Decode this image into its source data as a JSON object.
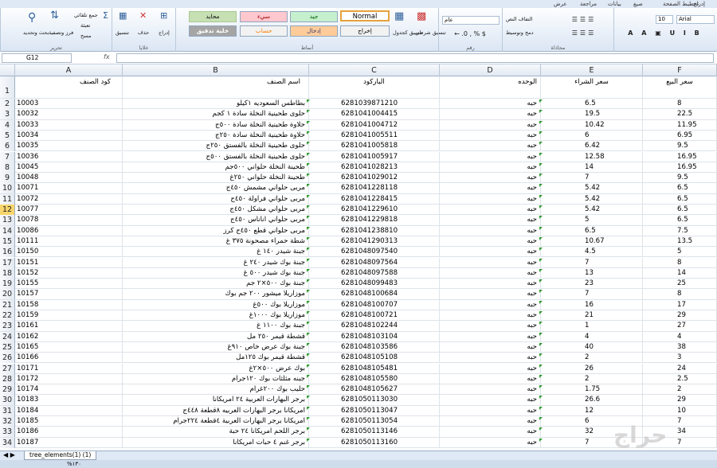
{
  "tabs": [
    "إدراج",
    "تخطيط الصفحة",
    "صيغ",
    "بيانات",
    "مراجعة",
    "عرض"
  ],
  "ribbon": {
    "font": {
      "name": "Arial",
      "size": "10",
      "label": ""
    },
    "alignment": {
      "wrap": "التفاف النص",
      "merge": "دمج وتوسيط",
      "label": "محاذاة"
    },
    "number": {
      "format": "عام",
      "label": "رقم"
    },
    "styles": {
      "conditional": "تنسيق شرطي",
      "as_table": "تنسيق كجدول",
      "boxes": [
        "Normal",
        "جيد",
        "سيء",
        "محايد",
        "إخراج",
        "إدخال",
        "حساب",
        "خلية تدقيق"
      ],
      "label": "أنماط"
    },
    "cells": {
      "insert": "إدراج",
      "delete": "حذف",
      "format": "تنسيق",
      "label": "خلايا"
    },
    "editing": {
      "autosum": "جمع تلقائي",
      "fill": "تعبئة",
      "clear": "مسح",
      "sort": "فرز وتصفية",
      "find": "بحث وتحديد",
      "label": "تحرير"
    }
  },
  "formula_bar": {
    "name_box": "G12",
    "fx": "fx",
    "content": ""
  },
  "columns": [
    "A",
    "B",
    "C",
    "D",
    "E",
    "F"
  ],
  "header_row": {
    "num": "1",
    "a": "كود الصنف",
    "b": "اسم الصنف",
    "c": "الباركود",
    "d": "الوحده",
    "e": "سعر الشراء",
    "f": "سعر البيع"
  },
  "rows": [
    {
      "num": "2",
      "a": "10003",
      "b": "بطاطس السعوديه ١كيلو",
      "c": "6281039871210",
      "d": "حبه",
      "e": "6.5",
      "f": "8"
    },
    {
      "num": "3",
      "a": "10032",
      "b": "حلوى طحينية النخلة سادة ١ كجم",
      "c": "6281041004415",
      "d": "حبه",
      "e": "19.5",
      "f": "22.5"
    },
    {
      "num": "4",
      "a": "10033",
      "b": "حلاوة طحينية النخلة سادة ٥٠٠ج",
      "c": "6281041004712",
      "d": "حبه",
      "e": "10.42",
      "f": "11.95"
    },
    {
      "num": "5",
      "a": "10034",
      "b": "حلاوة طحينية النخلة سادة ٢٥٠ج",
      "c": "6281041005511",
      "d": "حبه",
      "e": "6",
      "f": "6.95"
    },
    {
      "num": "6",
      "a": "10035",
      "b": "حلوى طحينية النخلة بالفستق ٢٥٠ج",
      "c": "6281041005818",
      "d": "حبه",
      "e": "6.42",
      "f": "9.5"
    },
    {
      "num": "7",
      "a": "10036",
      "b": "حلوى طحينية النخلة بالفستق ٥٠٠ج",
      "c": "6281041005917",
      "d": "حبه",
      "e": "12.58",
      "f": "16.95"
    },
    {
      "num": "8",
      "a": "10045",
      "b": "طحينة النخلة حلواني ٥٠٠جم",
      "c": "6281041028213",
      "d": "حبه",
      "e": "14",
      "f": "16.95"
    },
    {
      "num": "9",
      "a": "10048",
      "b": "طحينة النخلة حلواني ٢٥٠غ",
      "c": "6281041029012",
      "d": "حبه",
      "e": "7",
      "f": "9.5"
    },
    {
      "num": "10",
      "a": "10071",
      "b": "مربى حلواني مشمش ٤٥٠ج",
      "c": "6281041228118",
      "d": "حبه",
      "e": "5.42",
      "f": "6.5"
    },
    {
      "num": "11",
      "a": "10072",
      "b": "مربى حلواني فراولة ٤٥٠ج",
      "c": "6281041228415",
      "d": "حبه",
      "e": "5.42",
      "f": "6.5"
    },
    {
      "num": "12",
      "a": "10077",
      "b": "مربى حلواني مشكل ٤٥٠ج",
      "c": "6281041229610",
      "d": "حبه",
      "e": "5.42",
      "f": "6.5"
    },
    {
      "num": "13",
      "a": "10078",
      "b": "مربى حلواني اناناس ٤٥٠ج",
      "c": "6281041229818",
      "d": "حبه",
      "e": "5",
      "f": "6.5"
    },
    {
      "num": "14",
      "a": "10086",
      "b": "مربى حلواني قطع ٤٥٠ج كرز",
      "c": "6281041238810",
      "d": "حبه",
      "e": "6.5",
      "f": "7.5"
    },
    {
      "num": "15",
      "a": "10111",
      "b": "شطة حمراء مصحونة ٣٧٥ غ",
      "c": "6281041290313",
      "d": "حبه",
      "e": "10.67",
      "f": "13.5"
    },
    {
      "num": "16",
      "a": "10150",
      "b": "جبنة شيدر ١٤٠ غ",
      "c": "6281048097540",
      "d": "حبه",
      "e": "4.5",
      "f": "5"
    },
    {
      "num": "17",
      "a": "10151",
      "b": "جبنة بوك شيدر ٢٤٠ غ",
      "c": "6281048097564",
      "d": "حبه",
      "e": "7",
      "f": "8"
    },
    {
      "num": "18",
      "a": "10152",
      "b": "جبنة بوك شيدر ٥٠٠ غ",
      "c": "6281048097588",
      "d": "حبه",
      "e": "13",
      "f": "14"
    },
    {
      "num": "19",
      "a": "10155",
      "b": "جبنة بوك ٥٠٠×٢ جم",
      "c": "6281048099483",
      "d": "حبه",
      "e": "23",
      "f": "25"
    },
    {
      "num": "20",
      "a": "10157",
      "b": "موزاريلا ميشور ٢٠٠ جم بوك",
      "c": "6281048100684",
      "d": "حبه",
      "e": "7",
      "f": "8"
    },
    {
      "num": "21",
      "a": "10158",
      "b": "موزاريلا بوك ٥٠٠غ",
      "c": "6281048100707",
      "d": "حبه",
      "e": "16",
      "f": "17"
    },
    {
      "num": "22",
      "a": "10159",
      "b": "موزاريلا بوك ١٠٠٠غ",
      "c": "6281048100721",
      "d": "حبه",
      "e": "21",
      "f": "29"
    },
    {
      "num": "23",
      "a": "10161",
      "b": "جبنة بوك ١١٠٠ غ",
      "c": "6281048102244",
      "d": "حبه",
      "e": "1",
      "f": "27"
    },
    {
      "num": "24",
      "a": "10162",
      "b": "قشطة قيمر ٢٥٠ مل",
      "c": "6281048103104",
      "d": "حبه",
      "e": "4",
      "f": "4"
    },
    {
      "num": "25",
      "a": "10165",
      "b": "جبنة بوك عرض خاص ٩١٠غ",
      "c": "6281048103586",
      "d": "حبه",
      "e": "40",
      "f": "38"
    },
    {
      "num": "26",
      "a": "10166",
      "b": "قشطة قيمر بوك ١٢٥مل",
      "c": "6281048105108",
      "d": "حبه",
      "e": "2",
      "f": "3"
    },
    {
      "num": "27",
      "a": "10171",
      "b": "بوك عرض ٥٠٠×٢غ",
      "c": "6281048105481",
      "d": "حبه",
      "e": "26",
      "f": "24"
    },
    {
      "num": "28",
      "a": "10172",
      "b": "جبنه مثلثات بوك ١٢٠جرام",
      "c": "6281048105580",
      "d": "حبه",
      "e": "2",
      "f": "2.5"
    },
    {
      "num": "29",
      "a": "10174",
      "b": "حليب بوك ٢٠٠غرام",
      "c": "6281048105627",
      "d": "حبه",
      "e": "1.75",
      "f": "2"
    },
    {
      "num": "30",
      "a": "10183",
      "b": "برجر البهارات العربية ٢٤ امريكانا",
      "c": "6281050113030",
      "d": "حبه",
      "e": "26.6",
      "f": "29"
    },
    {
      "num": "31",
      "a": "10184",
      "b": "امريكانا برجر البهارات العربيه ٨قطعة ٤٤٨ج",
      "c": "6281050113047",
      "d": "حبه",
      "e": "12",
      "f": "10"
    },
    {
      "num": "32",
      "a": "10185",
      "b": "امريكانا برجر البهارات العربية ٤قطعة ٢٢٤جرام",
      "c": "6281050113054",
      "d": "حبه",
      "e": "6",
      "f": "7"
    },
    {
      "num": "33",
      "a": "10186",
      "b": "برجر اللحم امريكانا ٢٤ حبة",
      "c": "6281050113146",
      "d": "حبه",
      "e": "32",
      "f": "34"
    },
    {
      "num": "34",
      "a": "10187",
      "b": "برجر غنم ٤ حبات امريكانا",
      "c": "6281050113160",
      "d": "حبه",
      "e": "7",
      "f": "7"
    }
  ],
  "selected_row": "12",
  "sheet_tab": "tree_elements(1) (1)",
  "status": {
    "zoom": "%١٣٠"
  },
  "watermark": "حراج"
}
